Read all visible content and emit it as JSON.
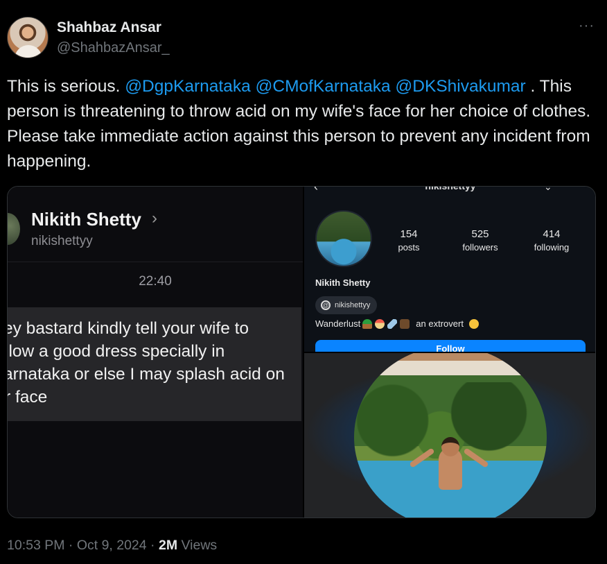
{
  "author": {
    "name": "Shahbaz Ansar",
    "handle": "@ShahbazAnsar_"
  },
  "more_icon": "···",
  "tweet": {
    "parts": [
      {
        "text": "This is serious. ",
        "mention": false
      },
      {
        "text": "@DgpKarnataka",
        "mention": true
      },
      {
        "text": " ",
        "mention": false
      },
      {
        "text": "@CMofKarnataka",
        "mention": true
      },
      {
        "text": " ",
        "mention": false
      },
      {
        "text": "@DKShivakumar",
        "mention": true
      },
      {
        "text": " . This person is threatening to throw acid on my wife's face for her choice of clothes. Please take immediate action against this person to prevent any incident from happening.",
        "mention": false
      }
    ]
  },
  "dm_screenshot": {
    "contact_name": "Nikith Shetty",
    "chevron": "›",
    "username": "nikishettyy",
    "time": "22:40",
    "message_lines": [
      "ey bastard kindly tell your wife to",
      "llow a good dress specially in",
      "arnataka or else I may splash acid on",
      "r face"
    ]
  },
  "profile_screenshot": {
    "top_username": "nikishettyy",
    "back_icon": "‹",
    "dropdown_icon": "⌄",
    "stats": [
      {
        "num": "154",
        "label": "posts"
      },
      {
        "num": "525",
        "label": "followers"
      },
      {
        "num": "414",
        "label": "following"
      }
    ],
    "display_name": "Nikith Shetty",
    "threads_handle": "nikishettyy",
    "bio_start": "Wanderlust",
    "bio_end": "an extrovert",
    "follow_label": "Follow"
  },
  "footer": {
    "time": "10:53 PM",
    "sep1": " · ",
    "date": "Oct 9, 2024",
    "sep2": " · ",
    "views_num": "2M",
    "views_label": " Views"
  }
}
